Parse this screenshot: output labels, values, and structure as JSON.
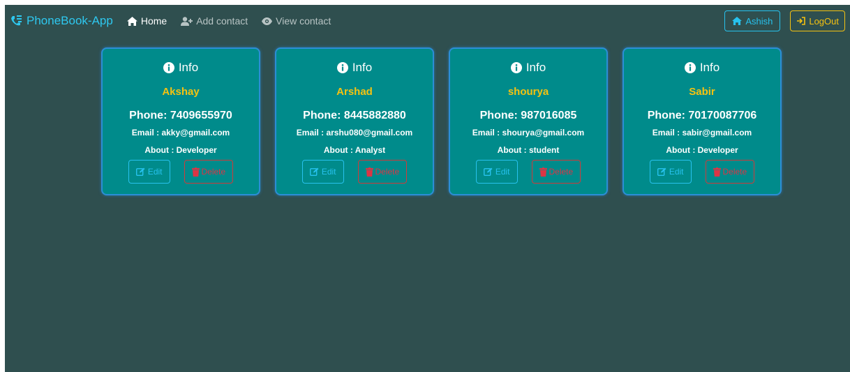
{
  "nav": {
    "brand": "PhoneBook-App",
    "home": "Home",
    "add_contact": "Add contact",
    "view_contact": "View contact",
    "user": "Ashish",
    "logout": "LogOut"
  },
  "colors": {
    "background": "#2f4f4f",
    "card": "#008b8b",
    "brand": "#2ec8f0",
    "name": "#f5c211",
    "delete": "#dc3545"
  },
  "contacts": [
    {
      "title": "Info",
      "name": "Akshay",
      "phone": "Phone: 7409655970",
      "email": "Email : akky@gmail.com",
      "about": "About : Developer",
      "edit": "Edit",
      "delete": "Delete"
    },
    {
      "title": "Info",
      "name": "Arshad",
      "phone": "Phone: 8445882880",
      "email": "Email : arshu080@gmail.com",
      "about": "About : Analyst",
      "edit": "Edit",
      "delete": "Delete"
    },
    {
      "title": "Info",
      "name": "shourya",
      "phone": "Phone: 987016085",
      "email": "Email : shourya@gmail.com",
      "about": "About : student",
      "edit": "Edit",
      "delete": "Delete"
    },
    {
      "title": "Info",
      "name": "Sabir",
      "phone": "Phone: 70170087706",
      "email": "Email : sabir@gmail.com",
      "about": "About : Developer",
      "edit": "Edit",
      "delete": "Delete"
    }
  ]
}
